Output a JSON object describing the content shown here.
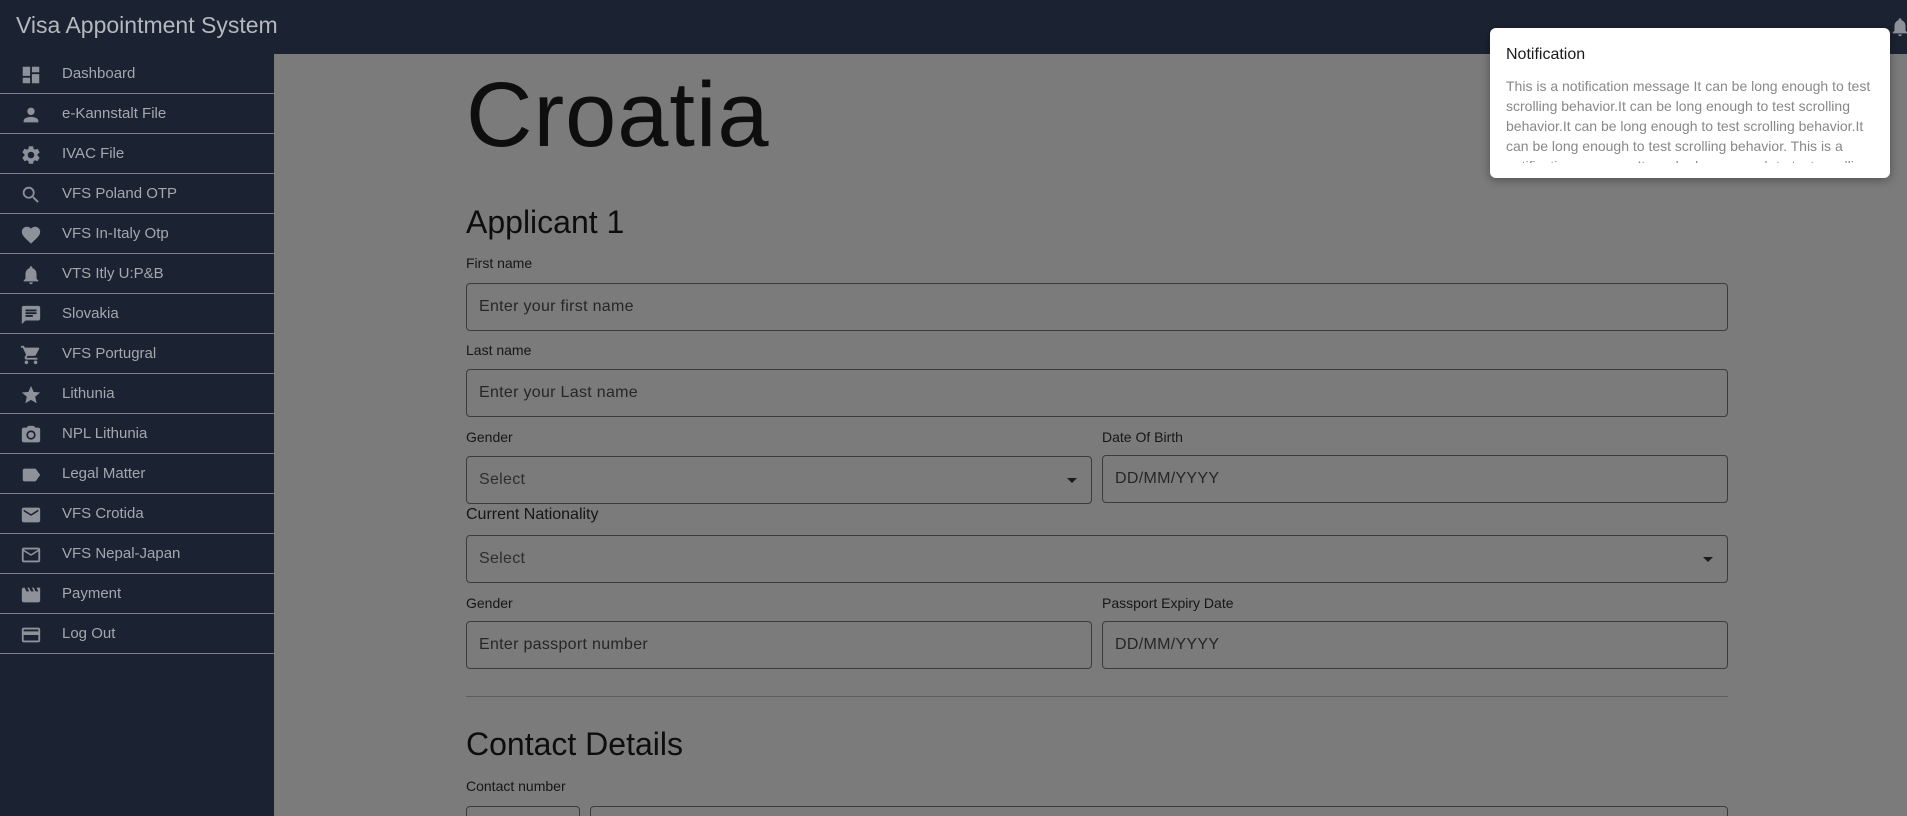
{
  "app": {
    "title": "Visa Appointment System"
  },
  "sidebar": {
    "items": [
      {
        "label": "Dashboard",
        "icon": "dashboard-icon"
      },
      {
        "label": "e-Kannstalt File",
        "icon": "person-icon"
      },
      {
        "label": "IVAC File",
        "icon": "gear-icon"
      },
      {
        "label": "VFS Poland OTP",
        "icon": "search-icon"
      },
      {
        "label": "VFS In-Italy Otp",
        "icon": "heart-icon"
      },
      {
        "label": "VTS Itly U:P&B",
        "icon": "bell-icon"
      },
      {
        "label": "Slovakia",
        "icon": "chat-icon"
      },
      {
        "label": "VFS Portugral",
        "icon": "cart-icon"
      },
      {
        "label": "Lithunia",
        "icon": "star-icon"
      },
      {
        "label": "NPL Lithunia",
        "icon": "camera-icon"
      },
      {
        "label": "Legal Matter",
        "icon": "label-icon"
      },
      {
        "label": "VFS Crotida",
        "icon": "mail-icon"
      },
      {
        "label": "VFS Nepal-Japan",
        "icon": "mail-outline-icon"
      },
      {
        "label": "Payment",
        "icon": "video-icon"
      },
      {
        "label": "Log Out",
        "icon": "card-icon"
      }
    ]
  },
  "page": {
    "country": "Croatia"
  },
  "applicant": {
    "heading": "Applicant 1",
    "first_name": {
      "label": "First name",
      "placeholder": "Enter your first name"
    },
    "last_name": {
      "label": "Last name",
      "placeholder": "Enter your Last name"
    },
    "gender": {
      "label": "Gender",
      "value": "Select"
    },
    "dob": {
      "label": "Date Of Birth",
      "placeholder": "DD/MM/YYYY"
    },
    "nationality": {
      "label": "Current Nationality",
      "value": "Select"
    },
    "passport": {
      "label": "Gender",
      "placeholder": "Enter passport number"
    },
    "passport_expiry": {
      "label": "Passport Expiry Date",
      "placeholder": "DD/MM/YYYY"
    }
  },
  "contact": {
    "heading": "Contact Details",
    "number_label": "Contact number"
  },
  "notification": {
    "title": "Notification",
    "body": "This is a notification message It can be long enough to test scrolling behavior.It can be long enough to test scrolling behavior.It can be long enough to test scrolling behavior.It can be long enough to test scrolling behavior. This is a notification message It can be long enough to test scrolling behavior."
  },
  "colors": {
    "sidebar_bg": "#1b2231",
    "overlay": "#7b7b7b"
  }
}
